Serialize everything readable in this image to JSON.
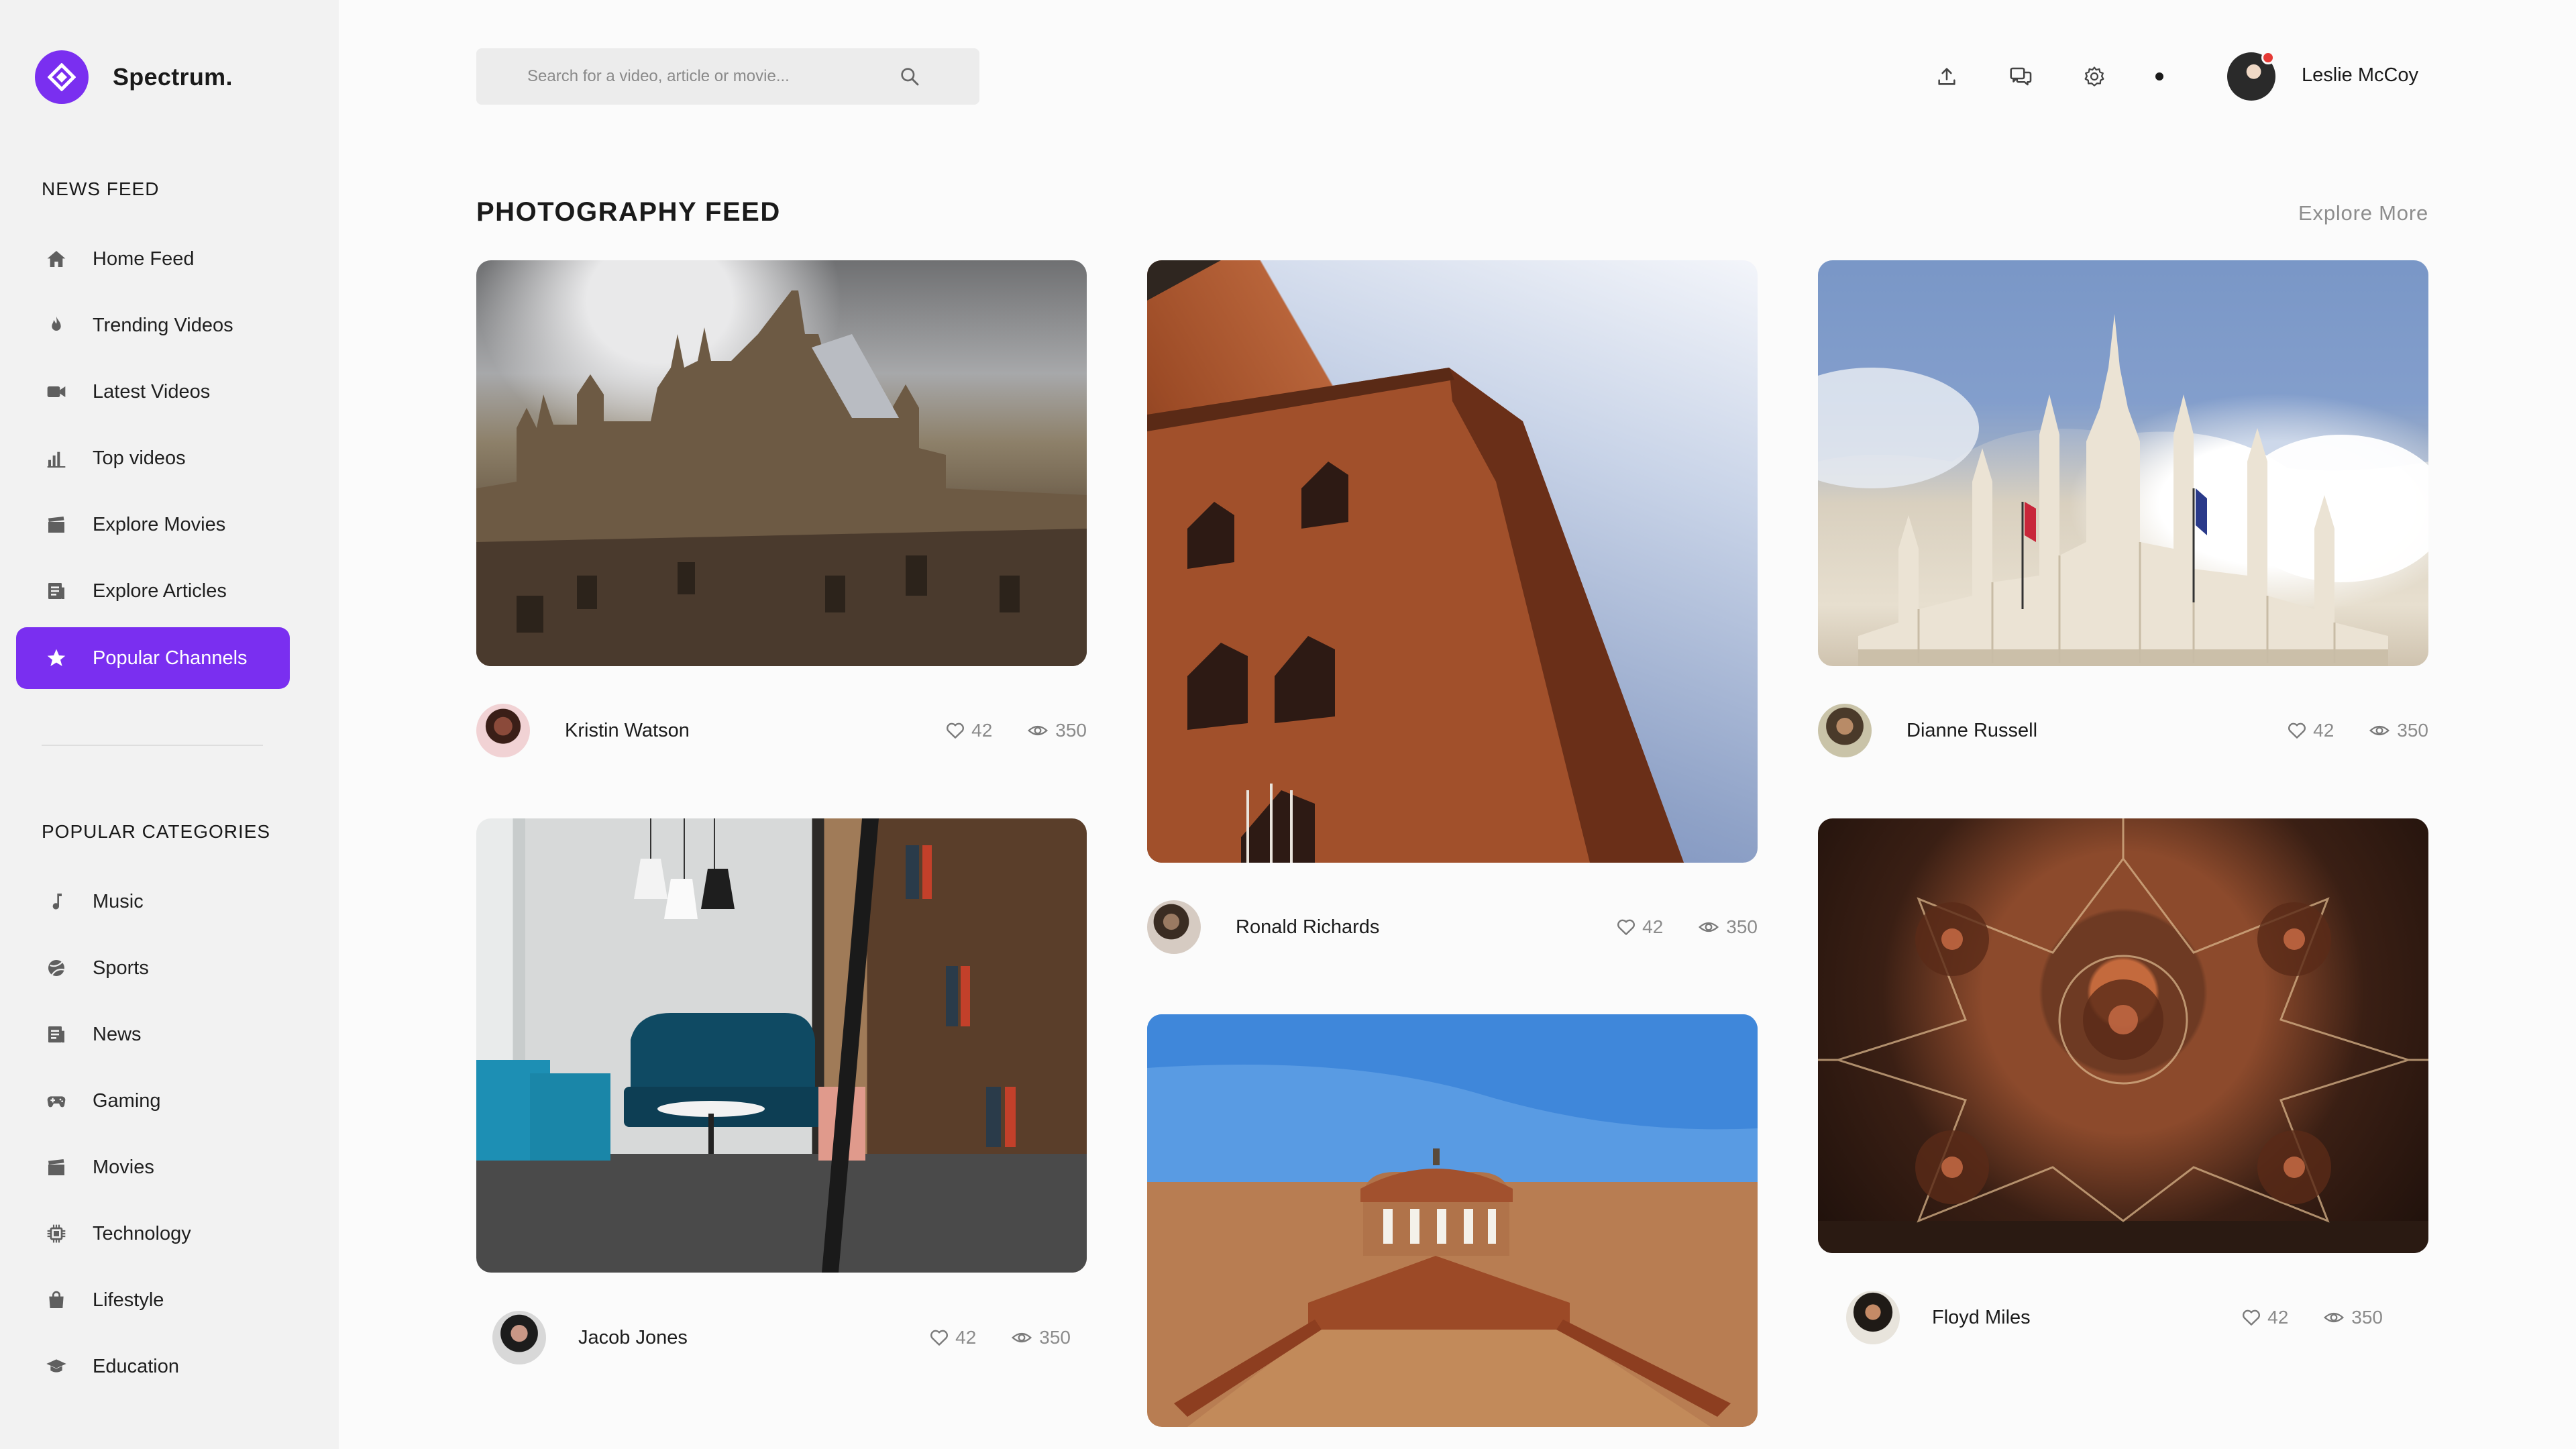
{
  "app": {
    "name": "Spectrum."
  },
  "sidebar": {
    "news_feed_title": "NEWS FEED",
    "news_items": [
      {
        "label": "Home Feed",
        "icon": "home-icon"
      },
      {
        "label": "Trending Videos",
        "icon": "flame-icon"
      },
      {
        "label": "Latest Videos",
        "icon": "video-camera-icon"
      },
      {
        "label": "Top videos",
        "icon": "bar-chart-icon"
      },
      {
        "label": "Explore Movies",
        "icon": "clapperboard-icon"
      },
      {
        "label": "Explore Articles",
        "icon": "article-icon"
      },
      {
        "label": "Popular Channels",
        "icon": "star-icon",
        "active": true
      }
    ],
    "categories_title": "POPULAR CATEGORIES",
    "category_items": [
      {
        "label": "Music",
        "icon": "music-note-icon"
      },
      {
        "label": "Sports",
        "icon": "ball-icon"
      },
      {
        "label": "News",
        "icon": "newspaper-icon"
      },
      {
        "label": "Gaming",
        "icon": "gamepad-icon"
      },
      {
        "label": "Movies",
        "icon": "clapperboard-icon"
      },
      {
        "label": "Technology",
        "icon": "chip-icon"
      },
      {
        "label": "Lifestyle",
        "icon": "shopping-bag-icon"
      },
      {
        "label": "Education",
        "icon": "graduation-cap-icon"
      }
    ]
  },
  "header": {
    "search_placeholder": "Search for a video, article or movie...",
    "icons": [
      "upload-icon",
      "chat-icon",
      "settings-icon"
    ],
    "user_name": "Leslie McCoy"
  },
  "feed": {
    "title": "PHOTOGRAPHY FEED",
    "explore_more": "Explore More",
    "cards": [
      {
        "author": "Kristin Watson",
        "likes": "42",
        "views": "350",
        "photo": "gothic cathedral over rooftops"
      },
      {
        "author": "Jacob Jones",
        "likes": "42",
        "views": "350",
        "photo": "library lounge with blue sofa"
      },
      {
        "author": "Ronald Richards",
        "likes": "42",
        "views": "350",
        "photo": "red brick tower against sky"
      },
      {
        "author": "",
        "likes": "",
        "views": "",
        "photo": "domed church under blue sky"
      },
      {
        "author": "Dianne Russell",
        "likes": "42",
        "views": "350",
        "photo": "white gothic cathedral spires"
      },
      {
        "author": "Floyd Miles",
        "likes": "42",
        "views": "350",
        "photo": "ornate mosaic ceiling"
      }
    ]
  },
  "colors": {
    "accent": "#7a2ff0",
    "sidebar_bg": "#f2f2f2",
    "page_bg": "#fbfbfb",
    "muted": "#8b8b8b",
    "badge": "#e53935"
  }
}
